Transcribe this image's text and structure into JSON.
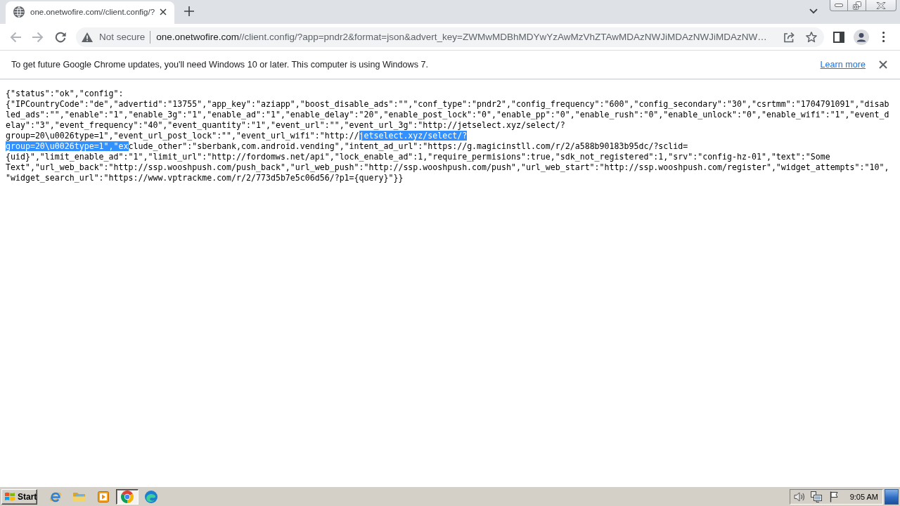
{
  "tabs": [
    {
      "title": "one.onetwofire.com//client.config/?",
      "selected": true
    }
  ],
  "toolbar": {
    "nav": [
      {
        "kind": "back",
        "disabled": true
      },
      {
        "kind": "forward",
        "disabled": true
      },
      {
        "kind": "reload",
        "disabled": false
      }
    ],
    "security": "Not secure",
    "url": {
      "host": "one.onetwofire.com",
      "path": "//client.config/?app=pndr2&format=json&advert_key=ZWMwMDBhMDYwYzAwMzVhZTAwMDAzNWJiMDAzNWJiMDAzNW…"
    }
  },
  "infobar": {
    "message": "To get future Google Chrome updates, you'll need Windows 10 or later. This computer is using Windows 7.",
    "link": "Learn more"
  },
  "page": {
    "lines": [
      {
        "segments": [
          {
            "text": "{\"status\":\"ok\",\"config\":",
            "selected": false
          }
        ]
      },
      {
        "segments": [
          {
            "text": "{\"IPCountryCode\":\"de\",\"advertid\":\"13755\",\"app_key\":\"aziapp\",\"boost_disable_ads\":\"\",\"conf_type\":\"pndr2\",\"config_frequency\":\"600\",\"config_secondary\":\"30\",\"csrtmm\":\"1704791091\",\"disab",
            "selected": false
          }
        ]
      },
      {
        "segments": [
          {
            "text": "led_ads\":\"\",\"enable\":\"1\",\"enable_3g\":\"1\",\"enable_ad\":\"1\",\"enable_delay\":\"20\",\"enable_post_lock\":\"0\",\"enable_pp\":\"0\",\"enable_rush\":\"0\",\"enable_unlock\":\"0\",\"enable_wifi\":\"1\",\"event_d",
            "selected": false
          }
        ]
      },
      {
        "segments": [
          {
            "text": "elay\":\"3\",\"event_frequency\":\"40\",\"event_quantity\":\"1\",\"event_url\":\"\",\"event_url_3g\":\"http://jetselect.xyz/select/?",
            "selected": false
          }
        ]
      },
      {
        "segments": [
          {
            "text": "group=20\\u0026type=1\",\"event_url_post_lock\":\"\",\"event_url_wifi\":\"http://",
            "selected": false
          },
          {
            "text": "jetselect.xyz/select/?",
            "selected": true
          }
        ]
      },
      {
        "segments": [
          {
            "text": "group=20\\u0026type=1\",\"ex",
            "selected": true
          },
          {
            "text": "clude_other\":\"sberbank,com.android.vending\",\"intent_ad_url\":\"https://g.magicinstll.com/r/2/a588b90183b95dc/?sclid=",
            "selected": false
          }
        ]
      },
      {
        "segments": [
          {
            "text": "{uid}\",\"limit_enable_ad\":\"1\",\"limit_url\":\"http://fordomws.net/api\",\"lock_enable_ad\":1,\"require_permisions\":true,\"sdk_not_registered\":1,\"srv\":\"config-hz-01\",\"text\":\"Some",
            "selected": false
          }
        ]
      },
      {
        "segments": [
          {
            "text": "Text\",\"url_web_back\":\"http://ssp.wooshpush.com/push_back\",\"url_web_push\":\"http://ssp.wooshpush.com/push\",\"url_web_start\":\"http://ssp.wooshpush.com/register\",\"widget_attempts\":\"10\",",
            "selected": false
          }
        ]
      },
      {
        "segments": [
          {
            "text": "\"widget_search_url\":\"https://www.vptrackme.com/r/2/773d5b7e5c06d56/?p1={query}\"}}",
            "selected": false
          }
        ]
      }
    ]
  },
  "taskbar": {
    "start": "Start",
    "apps": [
      {
        "kind": "e-logo",
        "selected": false
      },
      {
        "kind": "folder",
        "selected": false
      },
      {
        "kind": "player",
        "selected": false
      },
      {
        "kind": "round-logo",
        "selected": true
      },
      {
        "kind": "swirl",
        "selected": false
      }
    ],
    "clock": "9:05 AM"
  }
}
